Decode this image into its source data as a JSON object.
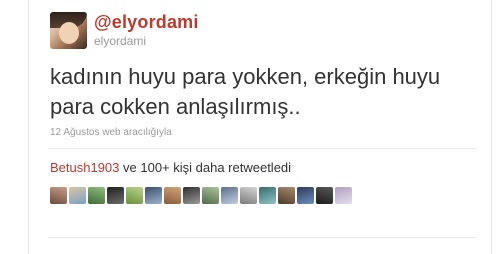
{
  "tweet": {
    "username": "@elyordami",
    "handle": "elyordami",
    "text_line1": "kadının huyu para yokken, erkeğin huyu",
    "text_line2": "para cokken anlaşılırmış..",
    "meta": "12 Ağustos web aracılığıyla"
  },
  "retweets": {
    "first_user": "Betush1903",
    "rest_text": " ve 100+ kişi daha retweetledi",
    "avatar_colors": [
      [
        "#6b4a3a",
        "#c9a08a"
      ],
      [
        "#d8c6a0",
        "#7aa0c8"
      ],
      [
        "#3e6b3a",
        "#8fbf7a"
      ],
      [
        "#1f1f1f",
        "#6d6d6d"
      ],
      [
        "#6a8f3a",
        "#b8d48a"
      ],
      [
        "#3b4f6b",
        "#9db2cc"
      ],
      [
        "#8a5a3a",
        "#d2a57a"
      ],
      [
        "#2f2f2f",
        "#9a9a9a"
      ],
      [
        "#4f6b4a",
        "#a9c49a"
      ],
      [
        "#5b6f8a",
        "#c2cedd"
      ],
      [
        "#7a7a7a",
        "#d6d6d6"
      ],
      [
        "#3a6b6b",
        "#8fc4c4"
      ],
      [
        "#4a3a2a",
        "#a98b6b"
      ],
      [
        "#2a3a5b",
        "#6f8fbf"
      ],
      [
        "#1a1a1a",
        "#5a5a5a"
      ],
      [
        "#b0a0c0",
        "#e6dcef"
      ]
    ]
  },
  "colors": {
    "accent": "#c0392b",
    "text": "#333333",
    "muted": "#9a9a9a"
  }
}
